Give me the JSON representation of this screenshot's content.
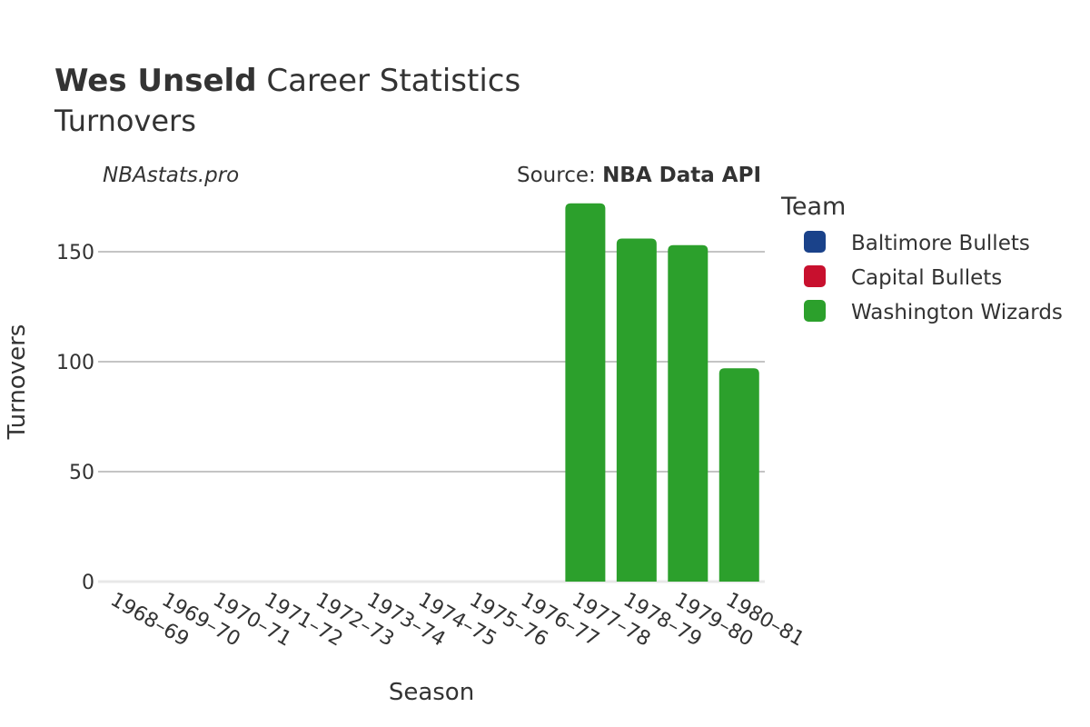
{
  "chart_data": {
    "type": "bar",
    "title_bold": "Wes Unseld",
    "title_rest": " Career Statistics",
    "subtitle": "Turnovers",
    "watermark": "NBAstats.pro",
    "source_prefix": "Source: ",
    "source_name": "NBA Data API",
    "xlabel": "Season",
    "ylabel": "Turnovers",
    "ylim": [
      0,
      180
    ],
    "yticks": [
      0,
      50,
      100,
      150
    ],
    "grid": true,
    "legend_title": "Team",
    "legend_position": "right",
    "categories": [
      "1968–69",
      "1969–70",
      "1970–71",
      "1971–72",
      "1972–73",
      "1973–74",
      "1974–75",
      "1975–76",
      "1976–77",
      "1977–78",
      "1978–79",
      "1979–80",
      "1980–81"
    ],
    "series": [
      {
        "name": "Baltimore Bullets",
        "color": "#1a428a",
        "values": [
          null,
          null,
          null,
          null,
          null,
          null,
          null,
          null,
          null,
          null,
          null,
          null,
          null
        ]
      },
      {
        "name": "Capital Bullets",
        "color": "#c8102e",
        "values": [
          null,
          null,
          null,
          null,
          null,
          null,
          null,
          null,
          null,
          null,
          null,
          null,
          null
        ]
      },
      {
        "name": "Washington Wizards",
        "color": "#2ca02c",
        "values": [
          null,
          null,
          null,
          null,
          null,
          null,
          null,
          null,
          null,
          172,
          156,
          153,
          97
        ]
      }
    ]
  }
}
